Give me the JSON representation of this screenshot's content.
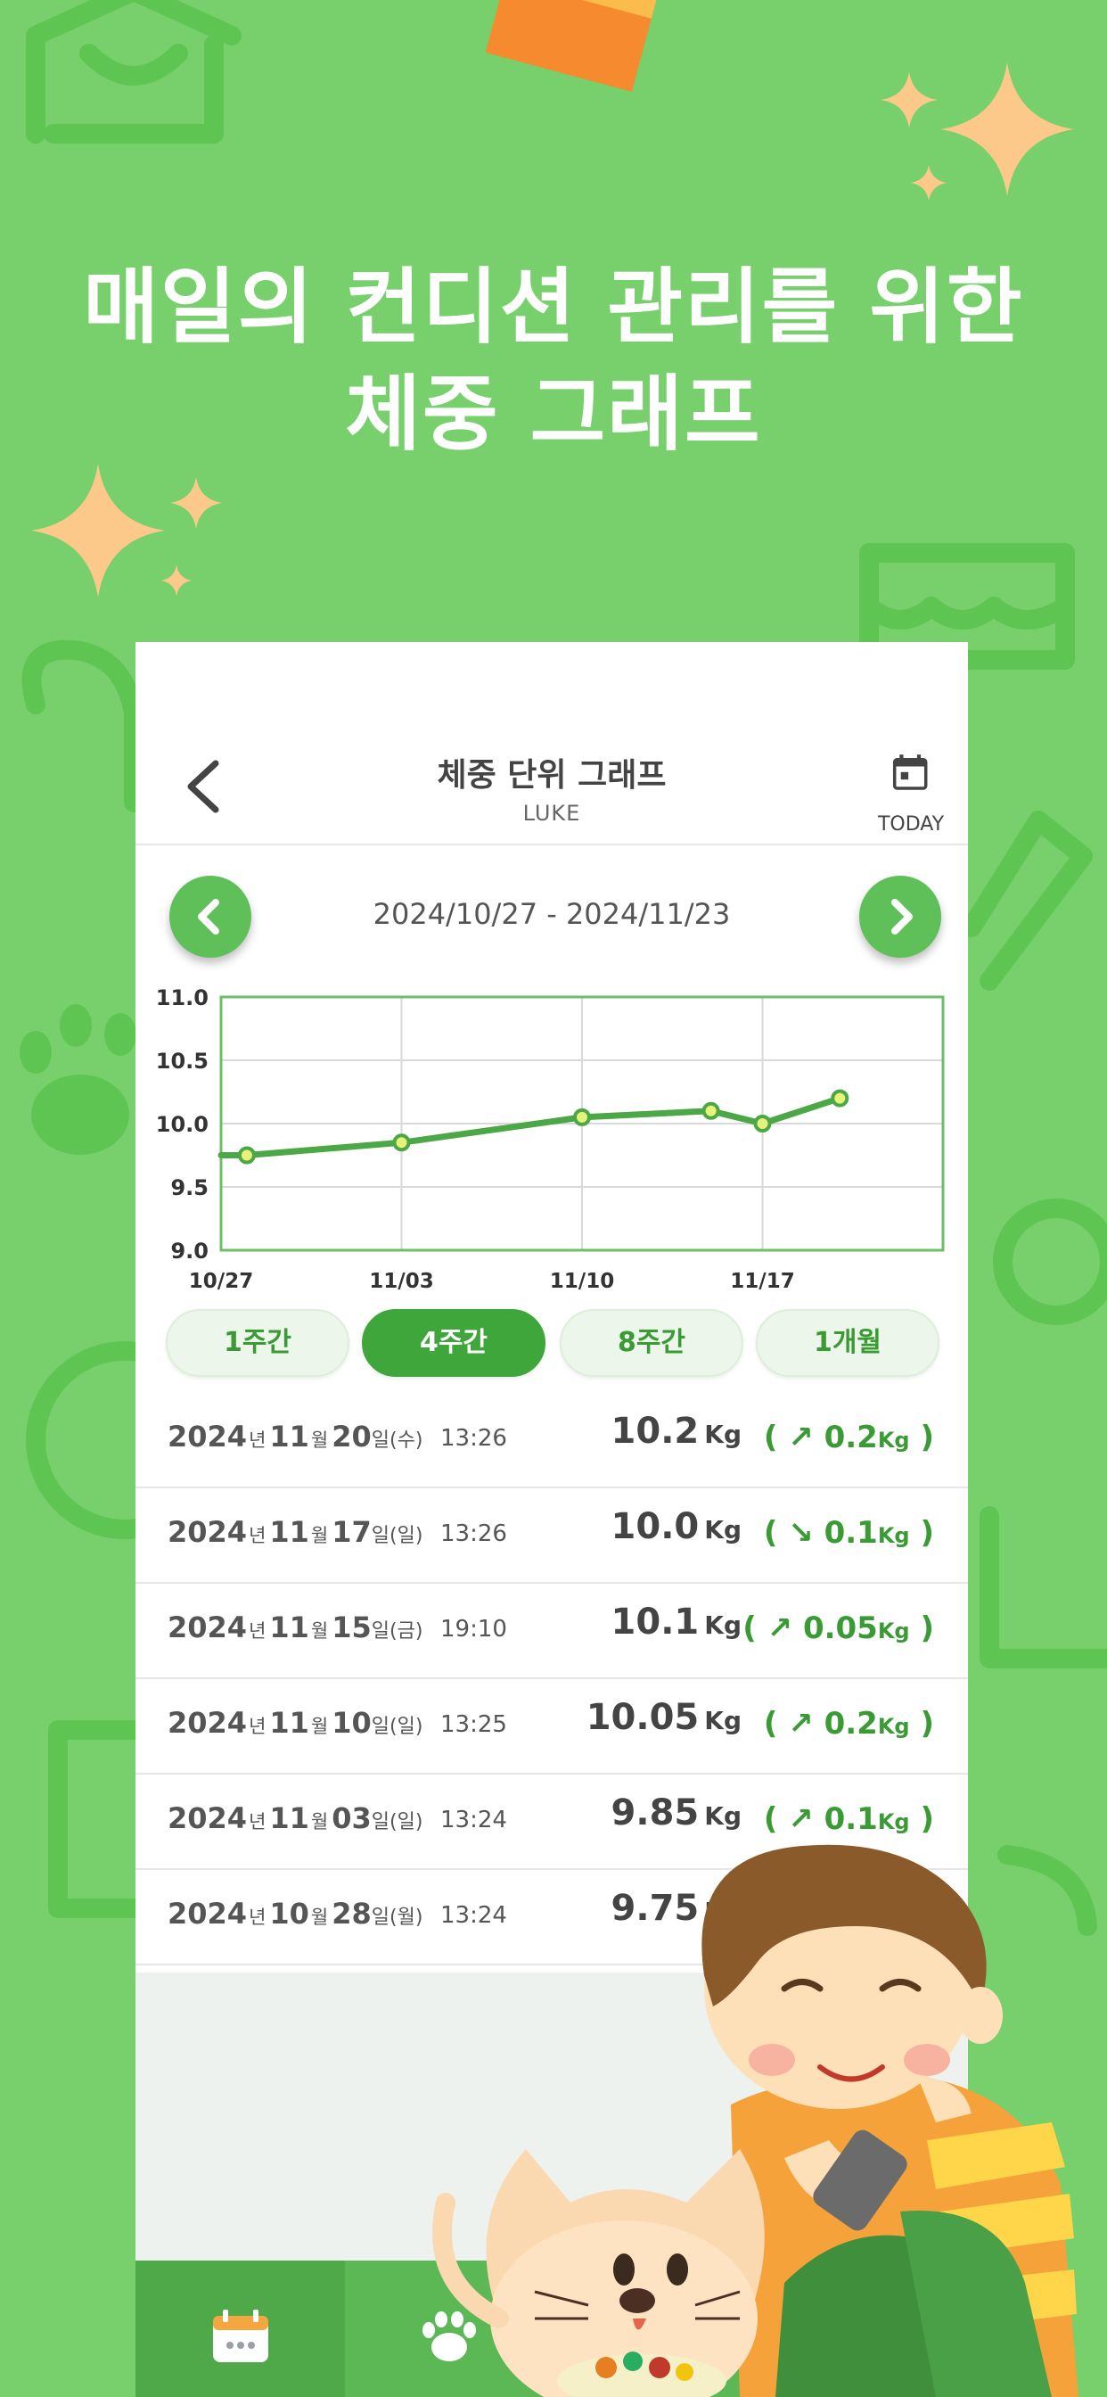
{
  "headline": {
    "line1": "매일의 컨디션 관리를 위한",
    "line2": "체중 그래프"
  },
  "header": {
    "title": "체중 단위 그래프",
    "subtitle": "LUKE",
    "today_label": "TODAY"
  },
  "date_range": "2024/10/27 - 2024/11/23",
  "period_tabs": [
    {
      "label": "1주간",
      "active": false
    },
    {
      "label": "4주간",
      "active": true
    },
    {
      "label": "8주간",
      "active": false
    },
    {
      "label": "1개월",
      "active": false
    }
  ],
  "chart_data": {
    "type": "line",
    "x_ticks": [
      "10/27",
      "11/03",
      "11/10",
      "11/17"
    ],
    "y_ticks": [
      "11.0",
      "10.5",
      "10.0",
      "9.5",
      "9.0"
    ],
    "ylim": [
      9.0,
      11.0
    ],
    "grid": true,
    "series": [
      {
        "points": [
          {
            "x": "10/27",
            "y": 9.75
          },
          {
            "x": "10/28",
            "y": 9.75
          },
          {
            "x": "11/03",
            "y": 9.85
          },
          {
            "x": "11/10",
            "y": 10.05
          },
          {
            "x": "11/15",
            "y": 10.1
          },
          {
            "x": "11/17",
            "y": 10.0
          },
          {
            "x": "11/20",
            "y": 10.2
          }
        ]
      }
    ],
    "colors": {
      "line": "#4ca846",
      "point": "#e6f27a",
      "frame": "#6cbf66",
      "grid": "#d9d9d9"
    }
  },
  "records": [
    {
      "year": "2024",
      "year_unit": "년",
      "month": "11",
      "month_unit": "월",
      "day": "20",
      "dow": "일(수)",
      "time": "13:26",
      "weight": "10.2",
      "unit": "Kg",
      "arrow": "↗",
      "delta": "0.2",
      "delta_unit": "Kg"
    },
    {
      "year": "2024",
      "year_unit": "년",
      "month": "11",
      "month_unit": "월",
      "day": "17",
      "dow": "일(일)",
      "time": "13:26",
      "weight": "10.0",
      "unit": "Kg",
      "arrow": "↘",
      "delta": "0.1",
      "delta_unit": "Kg"
    },
    {
      "year": "2024",
      "year_unit": "년",
      "month": "11",
      "month_unit": "월",
      "day": "15",
      "dow": "일(금)",
      "time": "19:10",
      "weight": "10.1",
      "unit": "Kg",
      "arrow": "↗",
      "delta": "0.05",
      "delta_unit": "Kg"
    },
    {
      "year": "2024",
      "year_unit": "년",
      "month": "11",
      "month_unit": "월",
      "day": "10",
      "dow": "일(일)",
      "time": "13:25",
      "weight": "10.05",
      "unit": "Kg",
      "arrow": "↗",
      "delta": "0.2",
      "delta_unit": "Kg"
    },
    {
      "year": "2024",
      "year_unit": "년",
      "month": "11",
      "month_unit": "월",
      "day": "03",
      "dow": "일(일)",
      "time": "13:24",
      "weight": "9.85",
      "unit": "Kg",
      "arrow": "↗",
      "delta": "0.1",
      "delta_unit": "Kg"
    },
    {
      "year": "2024",
      "year_unit": "년",
      "month": "10",
      "month_unit": "월",
      "day": "28",
      "dow": "일(월)",
      "time": "13:24",
      "weight": "9.75",
      "unit": "Kg"
    }
  ],
  "colors": {
    "background": "#77d06c",
    "accent": "#3fa63b",
    "bottom_bar": "#5cb854",
    "sparkle": "#fcc98a"
  },
  "icons": {
    "back": "chevron-left-icon",
    "today": "calendar-icon",
    "prev": "chevron-left-circle-icon",
    "next": "chevron-right-circle-icon",
    "tab_calendar": "calendar-tab-icon",
    "tab_paw": "paw-tab-icon"
  }
}
